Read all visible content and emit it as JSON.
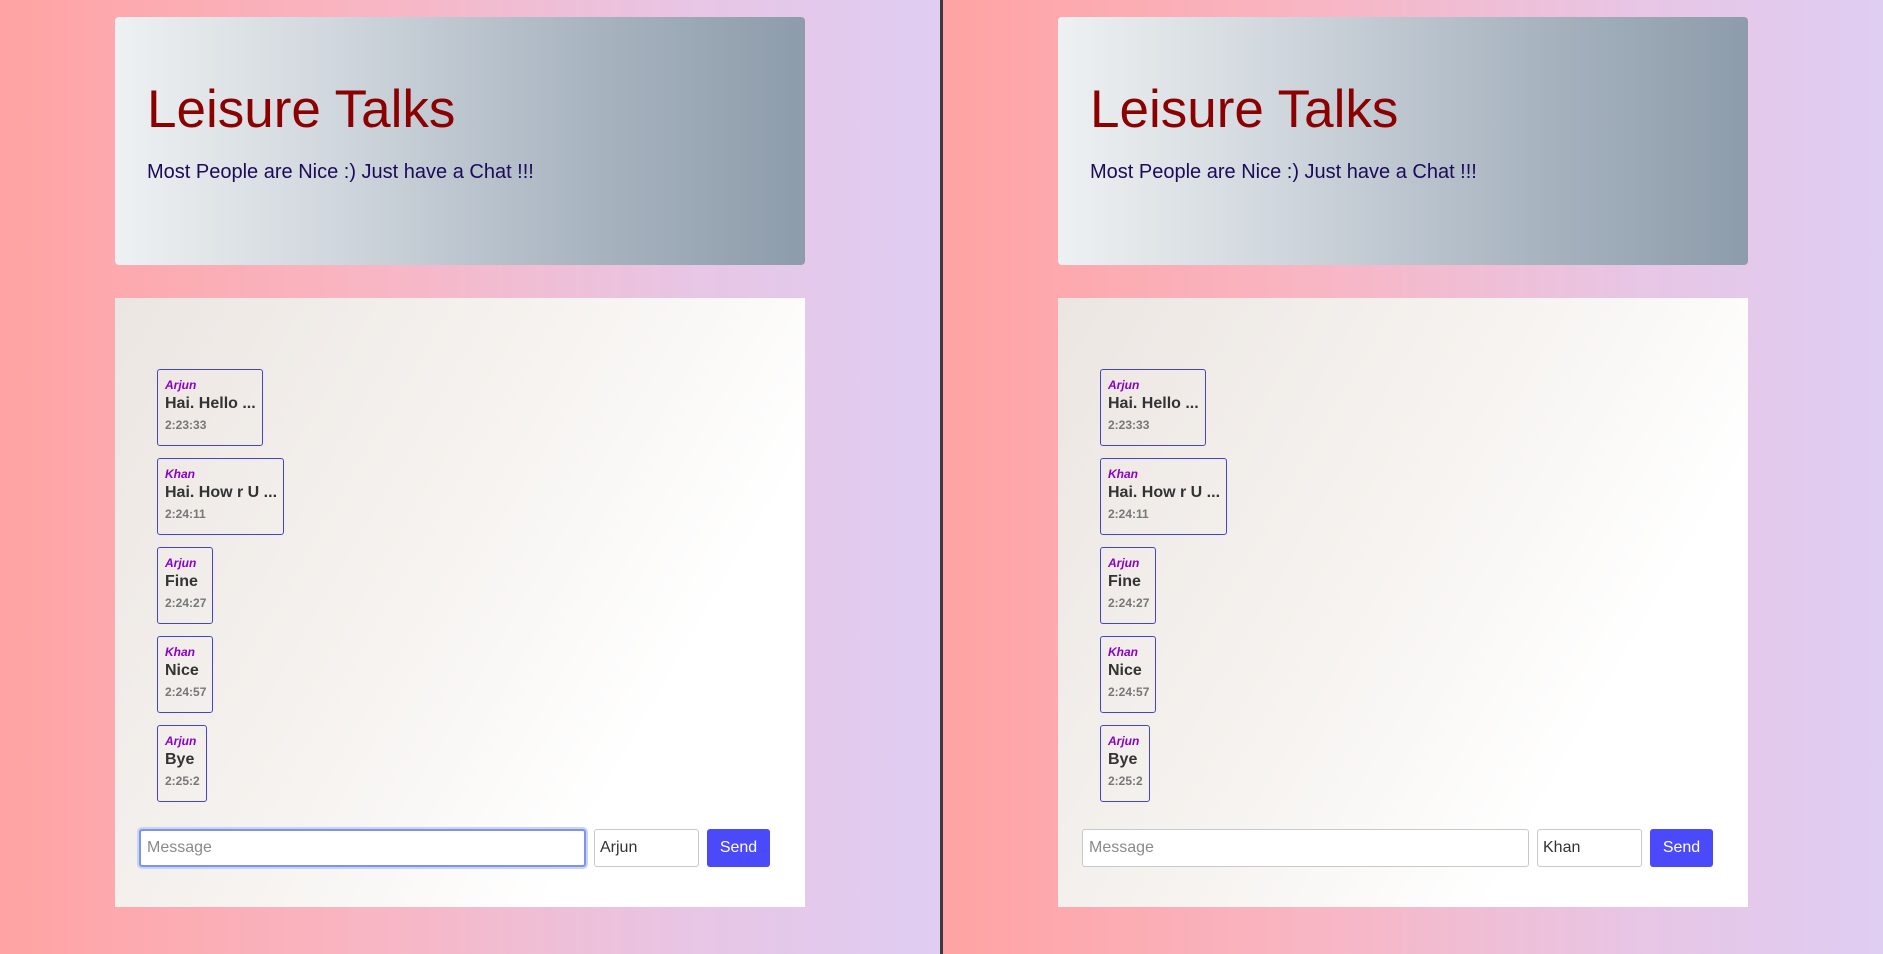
{
  "app": {
    "title": "Leisure Talks",
    "subtitle": "Most People are Nice :) Just have a Chat !!!"
  },
  "messages": [
    {
      "user": "Arjun",
      "text": "Hai. Hello ...",
      "time": "2:23:33"
    },
    {
      "user": "Khan",
      "text": "Hai. How r U ...",
      "time": "2:24:11"
    },
    {
      "user": "Arjun",
      "text": "Fine",
      "time": "2:24:27"
    },
    {
      "user": "Khan",
      "text": "Nice",
      "time": "2:24:57"
    },
    {
      "user": "Arjun",
      "text": "Bye",
      "time": "2:25:2"
    }
  ],
  "panes": [
    {
      "message_placeholder": "Message",
      "message_value": "",
      "name_value": "Arjun",
      "send_label": "Send",
      "message_focused": true
    },
    {
      "message_placeholder": "Message",
      "message_value": "",
      "name_value": "Khan",
      "send_label": "Send",
      "message_focused": false
    }
  ],
  "colors": {
    "title": "#8b0000",
    "subtitle": "#1c0a5a",
    "username": "#8b00c9",
    "bubble_border": "#4545cc",
    "send_button": "#4a4afa"
  }
}
